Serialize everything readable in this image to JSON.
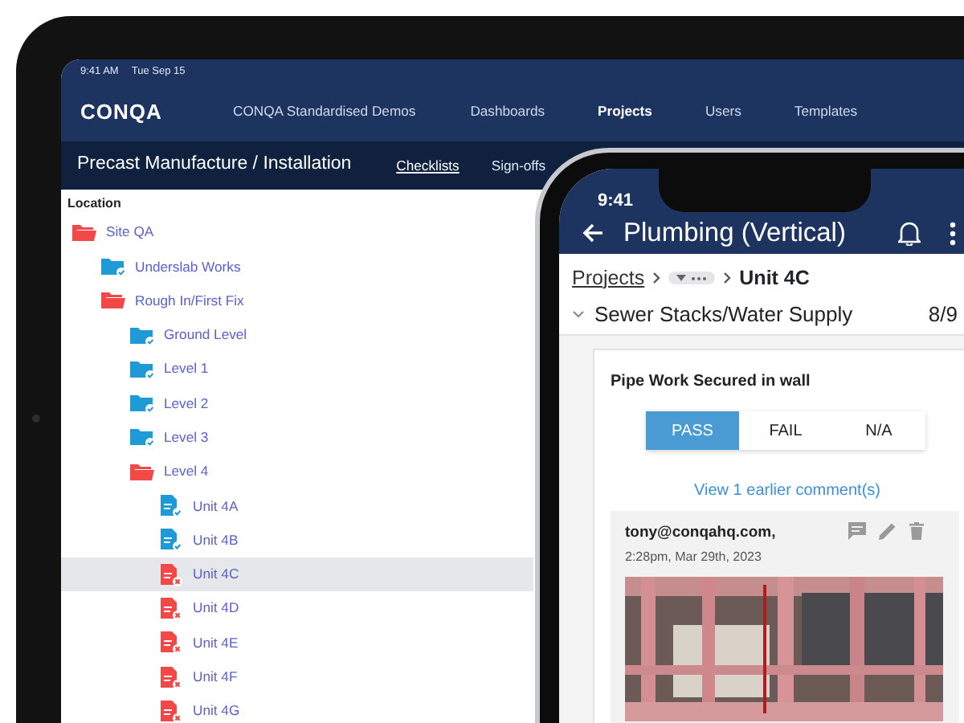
{
  "tablet": {
    "status_time": "9:41 AM",
    "status_date": "Tue Sep 15",
    "logo": "CONQA",
    "nav": [
      {
        "label": "CONQA Standardised Demos",
        "selected": false
      },
      {
        "label": "Dashboards",
        "selected": false
      },
      {
        "label": "Projects",
        "selected": true
      },
      {
        "label": "Users",
        "selected": false
      },
      {
        "label": "Templates",
        "selected": false
      }
    ],
    "project_title": "Precast Manufacture / Installation",
    "tabs": [
      {
        "label": "Checklists",
        "selected": true
      },
      {
        "label": "Sign-offs",
        "selected": false
      }
    ],
    "tree_heading": "Location",
    "tree": [
      {
        "label": "Site QA",
        "kind": "folder",
        "color": "#f24848",
        "expanded": true,
        "selected": false,
        "children": [
          {
            "label": "Underslab Works",
            "kind": "folder",
            "color": "#1e9ad6",
            "expanded": false,
            "selected": false
          },
          {
            "label": "Rough In/First Fix",
            "kind": "folder",
            "color": "#f24848",
            "expanded": true,
            "selected": false,
            "children": [
              {
                "label": "Ground Level",
                "kind": "folder",
                "color": "#1e9ad6",
                "expanded": false,
                "selected": false
              },
              {
                "label": "Level 1",
                "kind": "folder",
                "color": "#1e9ad6",
                "expanded": false,
                "selected": false
              },
              {
                "label": "Level 2",
                "kind": "folder",
                "color": "#1e9ad6",
                "expanded": false,
                "selected": false
              },
              {
                "label": "Level 3",
                "kind": "folder",
                "color": "#1e9ad6",
                "expanded": false,
                "selected": false
              },
              {
                "label": "Level 4",
                "kind": "folder",
                "color": "#f24848",
                "expanded": true,
                "selected": false,
                "children": [
                  {
                    "label": "Unit 4A",
                    "kind": "passed-unit",
                    "color": "#1e9ad6",
                    "selected": false
                  },
                  {
                    "label": "Unit 4B",
                    "kind": "passed-unit",
                    "color": "#1e9ad6",
                    "selected": false
                  },
                  {
                    "label": "Unit 4C",
                    "kind": "failed-unit",
                    "color": "#f24848",
                    "selected": true
                  },
                  {
                    "label": "Unit 4D",
                    "kind": "failed-unit",
                    "color": "#f24848",
                    "selected": false
                  },
                  {
                    "label": "Unit 4E",
                    "kind": "failed-unit",
                    "color": "#f24848",
                    "selected": false
                  },
                  {
                    "label": "Unit 4F",
                    "kind": "failed-unit",
                    "color": "#f24848",
                    "selected": false
                  },
                  {
                    "label": "Unit 4G",
                    "kind": "failed-unit",
                    "color": "#f24848",
                    "selected": false
                  }
                ]
              }
            ]
          }
        ]
      }
    ]
  },
  "phone": {
    "status_time": "9:41",
    "title": "Plumbing (Vertical)",
    "breadcrumb": {
      "root": "Projects",
      "current": "Unit 4C"
    },
    "section": {
      "title": "Sewer Stacks/Water Supply",
      "count": "8/9",
      "expanded": true
    },
    "item": {
      "question": "Pipe Work Secured in wall",
      "options": [
        {
          "label": "PASS",
          "selected": true
        },
        {
          "label": "FAIL",
          "selected": false
        },
        {
          "label": "N/A",
          "selected": false
        }
      ]
    },
    "earlier_comments_link": "View 1 earlier comment(s)",
    "comment": {
      "author": "tony@conqahq.com,",
      "timestamp": "2:28pm, Mar 29th, 2023"
    }
  }
}
